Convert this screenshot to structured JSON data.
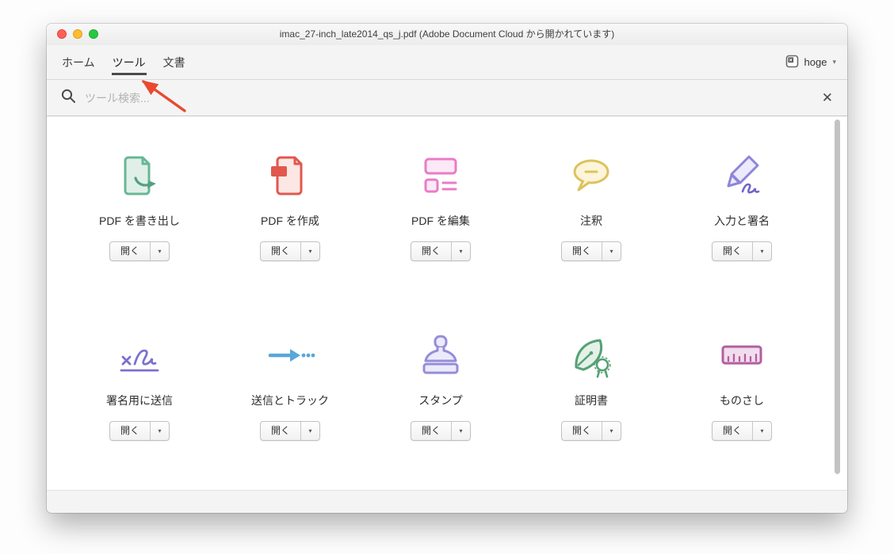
{
  "window": {
    "title": "imac_27-inch_late2014_qs_j.pdf (Adobe Document Cloud から開かれています)",
    "controls": [
      "close",
      "minimize",
      "zoom"
    ]
  },
  "nav": {
    "tabs": [
      {
        "label": "ホーム",
        "active": false
      },
      {
        "label": "ツール",
        "active": true
      },
      {
        "label": "文書",
        "active": false
      }
    ],
    "account": {
      "name": "hoge"
    }
  },
  "search": {
    "placeholder": "ツール検索..."
  },
  "icons": {
    "caret": "▾",
    "close": "✕"
  },
  "tools": [
    {
      "name": "PDF を書き出し",
      "icon": "export-pdf-icon",
      "open": "開く",
      "color": "#67b795"
    },
    {
      "name": "PDF を作成",
      "icon": "create-pdf-icon",
      "open": "開く",
      "color": "#e1584e"
    },
    {
      "name": "PDF を編集",
      "icon": "edit-pdf-icon",
      "open": "開く",
      "color": "#e87cc8"
    },
    {
      "name": "注釈",
      "icon": "comment-icon",
      "open": "開く",
      "color": "#ddc25e"
    },
    {
      "name": "入力と署名",
      "icon": "fill-and-sign-icon",
      "open": "開く",
      "color": "#8d85da"
    },
    {
      "name": "署名用に送信",
      "icon": "send-for-signature-icon",
      "open": "開く",
      "color": "#7b70cf"
    },
    {
      "name": "送信とトラック",
      "icon": "send-and-track-icon",
      "open": "開く",
      "color": "#58a7d9"
    },
    {
      "name": "スタンプ",
      "icon": "stamp-icon",
      "open": "開く",
      "color": "#968dda"
    },
    {
      "name": "証明書",
      "icon": "certificate-icon",
      "open": "開く",
      "color": "#55a173"
    },
    {
      "name": "ものさし",
      "icon": "measure-icon",
      "open": "開く",
      "color": "#b25fa0"
    }
  ],
  "annotation": {
    "type": "arrow",
    "color": "#e94a2f"
  }
}
